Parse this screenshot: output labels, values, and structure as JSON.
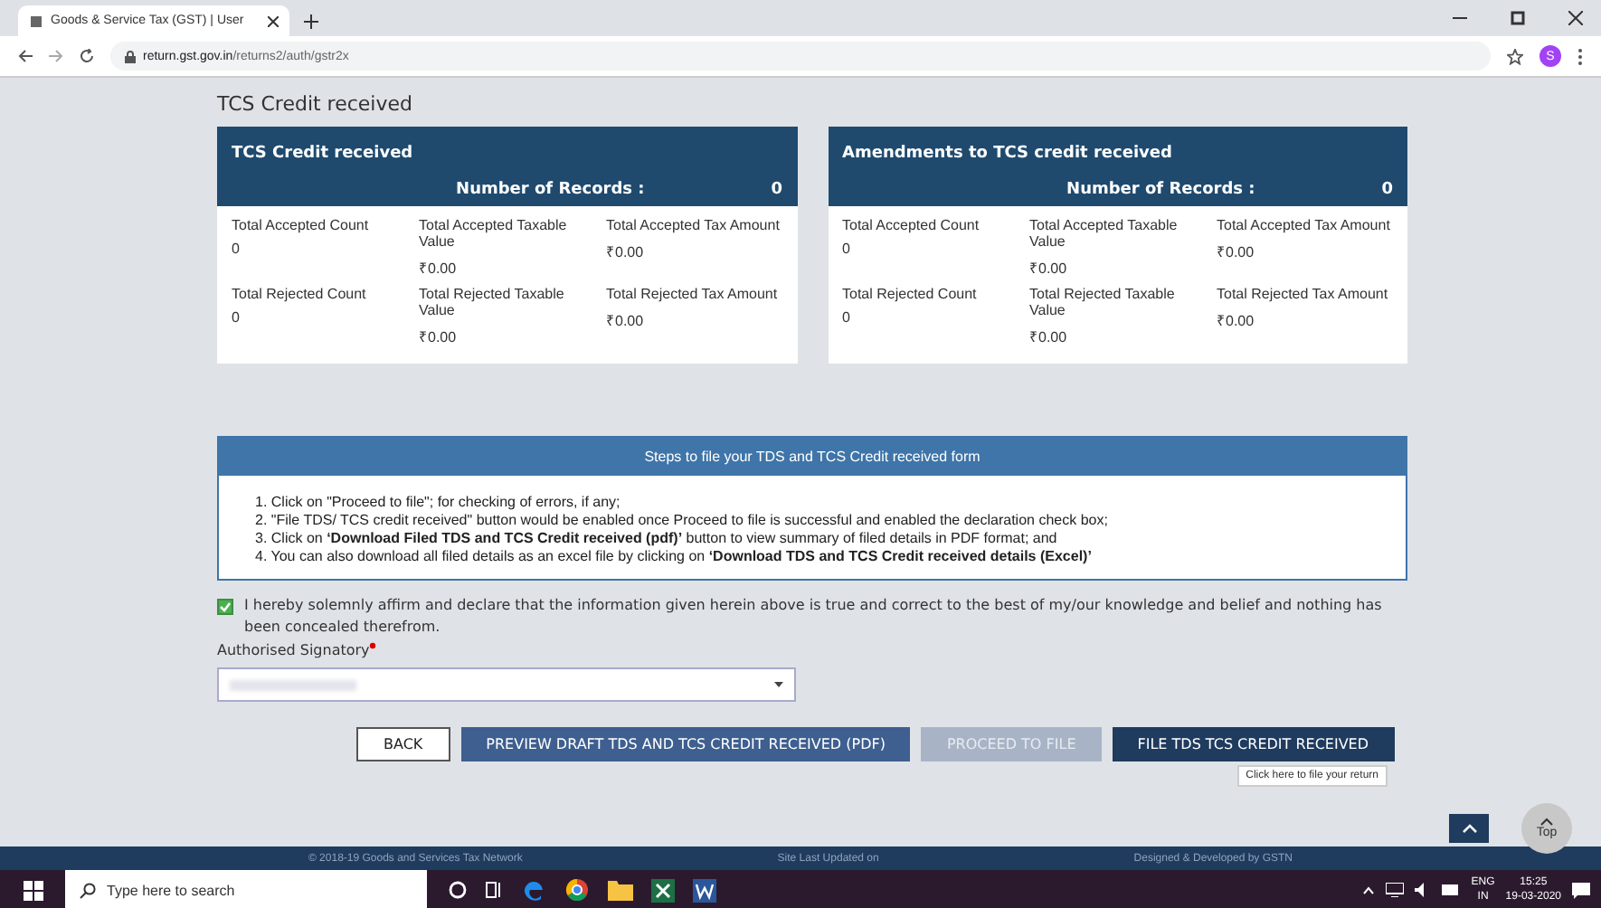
{
  "browser": {
    "tab_title": "Goods & Service Tax (GST) | User",
    "url_host": "return.gst.gov.in",
    "url_path": "/returns2/auth/gstr2x",
    "profile_initial": "S"
  },
  "page_title": "TCS Credit received",
  "cards": [
    {
      "title": "TCS Credit received",
      "records_label": "Number of Records :",
      "records_value": "0",
      "stats": [
        {
          "label": "Total Accepted Count",
          "value": "0"
        },
        {
          "label": "Total Accepted Taxable Value",
          "value": "₹0.00"
        },
        {
          "label": "Total Accepted Tax Amount",
          "value": "₹0.00"
        },
        {
          "label": "Total Rejected Count",
          "value": "0"
        },
        {
          "label": "Total Rejected Taxable Value",
          "value": "₹0.00"
        },
        {
          "label": "Total Rejected Tax Amount",
          "value": "₹0.00"
        }
      ]
    },
    {
      "title": "Amendments to TCS credit received",
      "records_label": "Number of Records :",
      "records_value": "0",
      "stats": [
        {
          "label": "Total Accepted Count",
          "value": "0"
        },
        {
          "label": "Total Accepted Taxable Value",
          "value": "₹0.00"
        },
        {
          "label": "Total Accepted Tax Amount",
          "value": "₹0.00"
        },
        {
          "label": "Total Rejected Count",
          "value": "0"
        },
        {
          "label": "Total Rejected Taxable Value",
          "value": "₹0.00"
        },
        {
          "label": "Total Rejected Tax Amount",
          "value": "₹0.00"
        }
      ]
    }
  ],
  "steps": {
    "title": "Steps to file your TDS and TCS Credit received form",
    "items": [
      "1. Click on \"Proceed to file\"; for checking of errors, if any;",
      "2. \"File TDS/ TCS credit received\" button would be enabled once Proceed to file is successful and enabled the declaration check box;",
      "3. Click on **‘Download Filed TDS and TCS Credit received (pdf)’** button to view summary of filed details in PDF format; and",
      "4. You can also download all filed details as an excel file by clicking on **‘Download TDS and TCS Credit received details (Excel)’**"
    ]
  },
  "declaration": {
    "checked": true,
    "text": "I hereby solemnly affirm and declare that the information given herein above is true and correct to the best of my/our knowledge and belief and nothing has been concealed therefrom."
  },
  "signatory": {
    "label": "Authorised Signatory",
    "required": true
  },
  "buttons": [
    {
      "label": "BACK",
      "kind": "outline",
      "disabled": false
    },
    {
      "label": "PREVIEW DRAFT TDS AND TCS CREDIT RECEIVED (PDF)",
      "kind": "primary",
      "disabled": false
    },
    {
      "label": "PROCEED TO FILE",
      "kind": "primary",
      "disabled": true
    },
    {
      "label": "FILE TDS TCS CREDIT RECEIVED",
      "kind": "dark",
      "disabled": false
    }
  ],
  "tooltip": "Click here to file your return",
  "top_button": "Top",
  "footer": [
    "© 2018-19 Goods and Services Tax Network",
    "Site Last Updated on",
    "Designed & Developed by GSTN"
  ],
  "taskbar": {
    "search_placeholder": "Type here to search",
    "lang_top": "ENG",
    "lang_bottom": "IN",
    "time": "15:25",
    "date": "19-03-2020"
  }
}
